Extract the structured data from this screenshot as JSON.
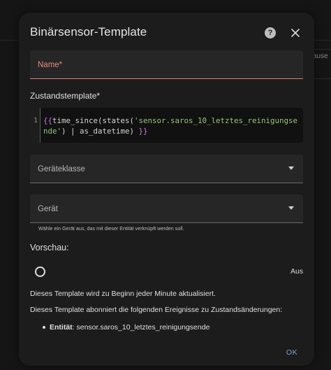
{
  "background": {
    "partial_text": "ause"
  },
  "dialog": {
    "title": "Binärsensor-Template",
    "help_icon": "help-circle-icon",
    "close_icon": "close-icon"
  },
  "form": {
    "name_field": {
      "label": "Name*",
      "value": ""
    },
    "state_template": {
      "label": "Zustandstemplate*",
      "line_number": "1",
      "code": {
        "open": "{{",
        "part1": "time_since(states(",
        "string": "'sensor.saros_10_letztes_reinigungsende'",
        "part2": ") | as_datetime) ",
        "close": "}}"
      }
    },
    "device_class_select": {
      "label": "Geräteklasse",
      "value": ""
    },
    "device_select": {
      "label": "Gerät",
      "value": "",
      "helper": "Wähle ein Gerät aus, das mit dieser Entität verknüpft werden soll."
    }
  },
  "preview": {
    "heading": "Vorschau:",
    "state_icon": "circle-outline-icon",
    "state_value": "Aus",
    "info_update": "Dieses Template wird zu Beginn jeder Minute aktualisiert.",
    "info_events": "Dieses Template abonniert die folgenden Ereignisse zu Zustandsänderungen:",
    "events": [
      {
        "key": "Entität",
        "value": ": sensor.saros_10_letztes_reinigungsende"
      }
    ]
  },
  "actions": {
    "ok_label": "OK"
  },
  "colors": {
    "error": "#e07a6f",
    "accent": "#7fa7d8",
    "template_brace": "#c678dd",
    "template_string": "#98c379"
  }
}
